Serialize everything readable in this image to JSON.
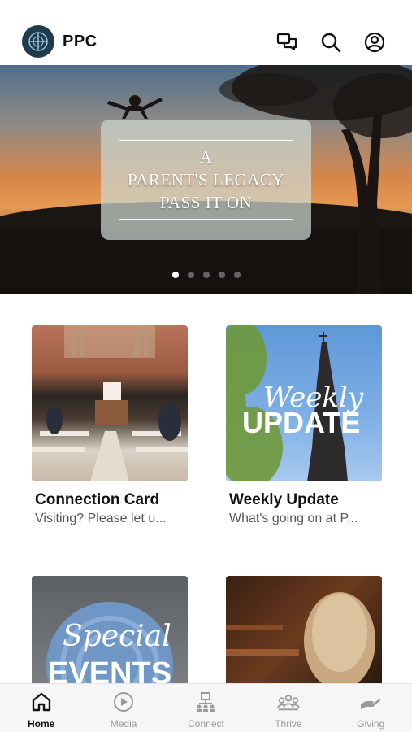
{
  "header": {
    "app_name": "PPC",
    "icons": [
      "logo-icon",
      "chat-icon",
      "search-icon",
      "profile-icon"
    ]
  },
  "hero": {
    "lines": [
      "A",
      "PARENT'S LEGACY",
      "PASS IT ON"
    ],
    "slide_count": 5,
    "active_slide": 1
  },
  "tiles": [
    {
      "title": "Connection Card",
      "subtitle": "Visiting? Please let u...",
      "image": "church-choir-photo"
    },
    {
      "title": "Weekly Update",
      "subtitle": "What's going on at P...",
      "image": "steeple-photo",
      "overlay_script": "Weekly",
      "overlay_caps": "UPDATE"
    },
    {
      "title": "",
      "subtitle": "",
      "image": "special-events-photo",
      "overlay_script": "Special",
      "overlay_caps": "EVENTS"
    },
    {
      "title": "",
      "subtitle": "",
      "image": "woman-in-pew-photo"
    }
  ],
  "tabbar": {
    "items": [
      {
        "label": "Home",
        "icon": "home-icon",
        "active": true
      },
      {
        "label": "Media",
        "icon": "play-icon",
        "active": false
      },
      {
        "label": "Connect",
        "icon": "connect-icon",
        "active": false
      },
      {
        "label": "Thrive",
        "icon": "group-icon",
        "active": false
      },
      {
        "label": "Giving",
        "icon": "giving-hand-icon",
        "active": false
      }
    ]
  },
  "colors": {
    "accent": "#1f3b4d",
    "text": "#111111",
    "muted": "#9a9a9a"
  }
}
